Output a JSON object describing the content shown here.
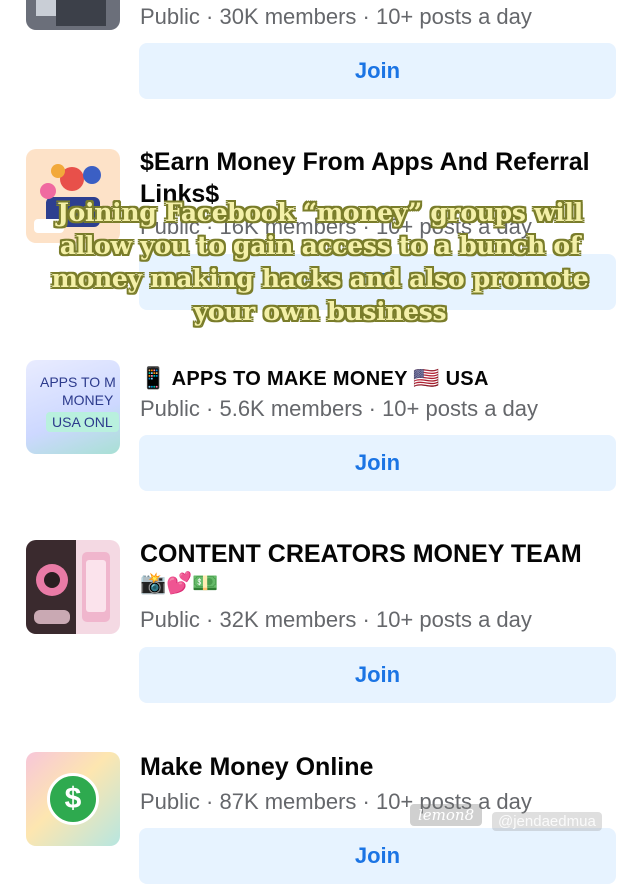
{
  "groups": [
    {
      "title": "",
      "meta": "Public · 30K members · 10+ posts a day",
      "join_label": "Join"
    },
    {
      "title": "$Earn Money From Apps And Referral Links$",
      "meta": "Public · 16K members · 10+ posts a day",
      "join_label": "Join"
    },
    {
      "title_prefix": "📱",
      "title": "APPS TO MAKE MONEY",
      "title_flag": "🇺🇸",
      "title_suffix": "USA",
      "thumb_text": [
        "APPS TO M",
        "MONEY",
        "USA ONL"
      ],
      "meta": "Public · 5.6K members · 10+ posts a day",
      "join_label": "Join"
    },
    {
      "title": "CONTENT CREATORS MONEY TEAM",
      "title_emojis": "📸💕💵",
      "meta": "Public · 32K members · 10+ posts a day",
      "join_label": "Join"
    },
    {
      "title": "Make Money Online",
      "thumb_symbol": "$",
      "meta": "Public · 87K members · 10+ posts a day",
      "join_label": "Join"
    }
  ],
  "overlay_caption": [
    "Joining Facebook “money” groups will",
    "allow you to gain access to a bunch of",
    "money making hacks and also promote",
    "your own business"
  ],
  "watermark": "lemon8",
  "handle": "@jendaedmua",
  "colors": {
    "join_bg": "#e7f3ff",
    "join_text": "#1b74e4",
    "meta_text": "#65676b",
    "caption_fill": "#f4f0a8",
    "caption_outline": "#7a7d2a"
  }
}
